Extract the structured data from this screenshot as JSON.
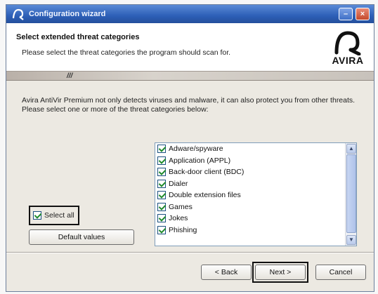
{
  "window": {
    "title": "Configuration wizard",
    "min_label": "–",
    "close_label": "×"
  },
  "header": {
    "title": "Select extended threat categories",
    "subtitle": "Please select the threat categories the program should scan for.",
    "logo_text": "AVIRA"
  },
  "stripe": {
    "mark": "///"
  },
  "description": "Avira AntiVir Premium not only detects viruses and malware, it can also protect you from other threats. Please select one or more of the threat categories below:",
  "threats": [
    {
      "label": "Adware/spyware",
      "checked": true
    },
    {
      "label": "Application (APPL)",
      "checked": true
    },
    {
      "label": "Back-door client (BDC)",
      "checked": true
    },
    {
      "label": "Dialer",
      "checked": true
    },
    {
      "label": "Double extension files",
      "checked": true
    },
    {
      "label": "Games",
      "checked": true
    },
    {
      "label": "Jokes",
      "checked": true
    },
    {
      "label": "Phishing",
      "checked": true
    }
  ],
  "select_all": {
    "label": "Select all",
    "checked": true
  },
  "buttons": {
    "default_values": "Default values",
    "back": "< Back",
    "next": "Next >",
    "cancel": "Cancel"
  },
  "colors": {
    "titlebar": "#2d5fb7",
    "logo_red": "#c8102e"
  }
}
